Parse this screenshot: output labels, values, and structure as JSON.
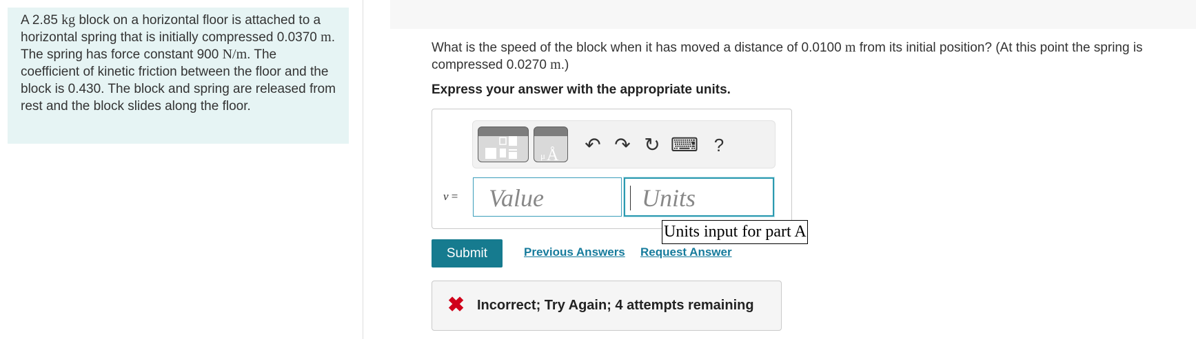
{
  "problem": {
    "p1": "A 2.85",
    "m1": "kg",
    "p2": "block on a horizontal floor is attached to a horizontal spring that is initially compressed 0.0370",
    "m2": "m",
    "p3": ". The spring has force constant 900",
    "m3": "N/m",
    "p4": ". The coefficient of kinetic friction between the floor and the block is 0.430. The block and spring are released from rest and the block slides along the floor."
  },
  "question": {
    "q1": "What is the speed of the block when it has moved a distance of 0.0100",
    "m1": "m",
    "q2": "from its initial position? (At this point the spring is compressed 0.0270",
    "m2": "m",
    "q3": ".)"
  },
  "instruction": "Express your answer with the appropriate units.",
  "toolbar": {
    "templates_icon": "templates-icon",
    "units_icon": "units-icon",
    "units_glyph_mu": "μ",
    "units_glyph_angstrom": "Å",
    "undo_glyph": "↶",
    "redo_glyph": "↷",
    "reset_glyph": "↻",
    "keyboard_glyph": "⌨",
    "help_label": "?"
  },
  "answer": {
    "variable": "v",
    "equals": "=",
    "value_placeholder": "Value",
    "units_placeholder": "Units",
    "units_tooltip": "Units input for part A"
  },
  "actions": {
    "submit_label": "Submit",
    "previous_answers_label": "Previous Answers",
    "request_answer_label": "Request Answer"
  },
  "feedback": {
    "icon": "✖",
    "message": "Incorrect; Try Again; 4 attempts remaining"
  },
  "colors": {
    "problem_bg": "#e6f4f4",
    "accent": "#167b8f",
    "link": "#167b9c",
    "error": "#d0021b"
  }
}
